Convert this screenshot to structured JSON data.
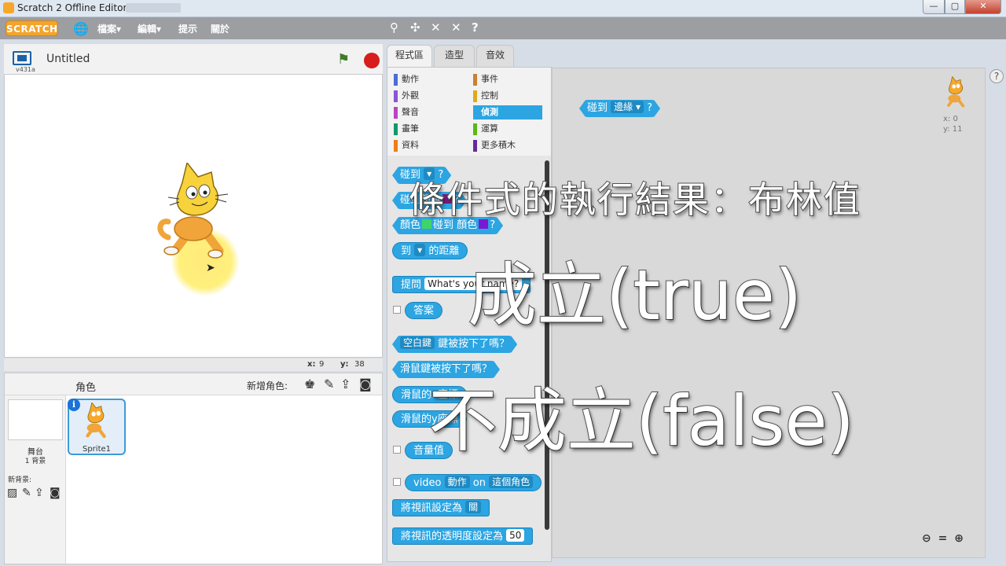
{
  "window": {
    "title": "Scratch 2 Offline Editor",
    "minimize": "—",
    "maximize": "▢",
    "close": "✕"
  },
  "menubar": {
    "logo": "SCRATCH",
    "file": "檔案▾",
    "edit": "編輯▾",
    "tips": "提示",
    "about": "關於"
  },
  "stage": {
    "version": "v431a",
    "project_title": "Untitled",
    "mouse_x_label": "x:",
    "mouse_x": "9",
    "mouse_y_label": "y:",
    "mouse_y": "38"
  },
  "sprites_panel": {
    "label": "角色",
    "new_sprite_label": "新增角色:",
    "stage_name": "舞台",
    "backdrop_count": "1 背景",
    "new_backdrop_label": "新背景:",
    "sprite_name": "Sprite1"
  },
  "tabs": [
    "程式區",
    "造型",
    "音效"
  ],
  "categories": {
    "left": [
      {
        "label": "動作",
        "color": "#4a6cd4"
      },
      {
        "label": "外觀",
        "color": "#8a55d7"
      },
      {
        "label": "聲音",
        "color": "#bb42c3"
      },
      {
        "label": "畫筆",
        "color": "#0e9a6c"
      },
      {
        "label": "資料",
        "color": "#ee7d16"
      }
    ],
    "right": [
      {
        "label": "事件",
        "color": "#c88330"
      },
      {
        "label": "控制",
        "color": "#e1a91a"
      },
      {
        "label": "偵測",
        "color": "#2ca5e2"
      },
      {
        "label": "運算",
        "color": "#5cb712"
      },
      {
        "label": "更多積木",
        "color": "#632d99"
      }
    ]
  },
  "blocks": {
    "touching": "碰到",
    "touching_color": "碰到顏色",
    "color_word": "顏色",
    "color_touching": "碰到",
    "distance_to": "到",
    "distance_suffix": "的距離",
    "ask": "提問",
    "ask_default": "What's your name?",
    "answer": "答案",
    "key": "空白鍵",
    "key_pressed": "鍵被按下了嗎？",
    "mouse_down": "滑鼠鍵被按下了嗎？",
    "mouse_x": "滑鼠的x座標",
    "mouse_y": "滑鼠的y座標",
    "loudness": "音量值",
    "video": "video",
    "video_motion": "動作",
    "video_on": "on",
    "video_this": "這個角色",
    "turn_video": "將視訊設定為",
    "video_off": "關",
    "transparency": "將視訊的透明度設定為",
    "transparency_value": "50",
    "question_mark": "?"
  },
  "script_canvas": {
    "block_text": "碰到",
    "block_option": "邊緣",
    "sprite_x": "x: 0",
    "sprite_y": "y: 11"
  },
  "captions": {
    "line1": "條件式的執行結果：布林值",
    "line2": "成立(true)",
    "line3": "不成立(false)"
  },
  "icons": {
    "green_flag": "green-flag-icon",
    "stop": "stop-icon",
    "globe": "globe-icon"
  }
}
